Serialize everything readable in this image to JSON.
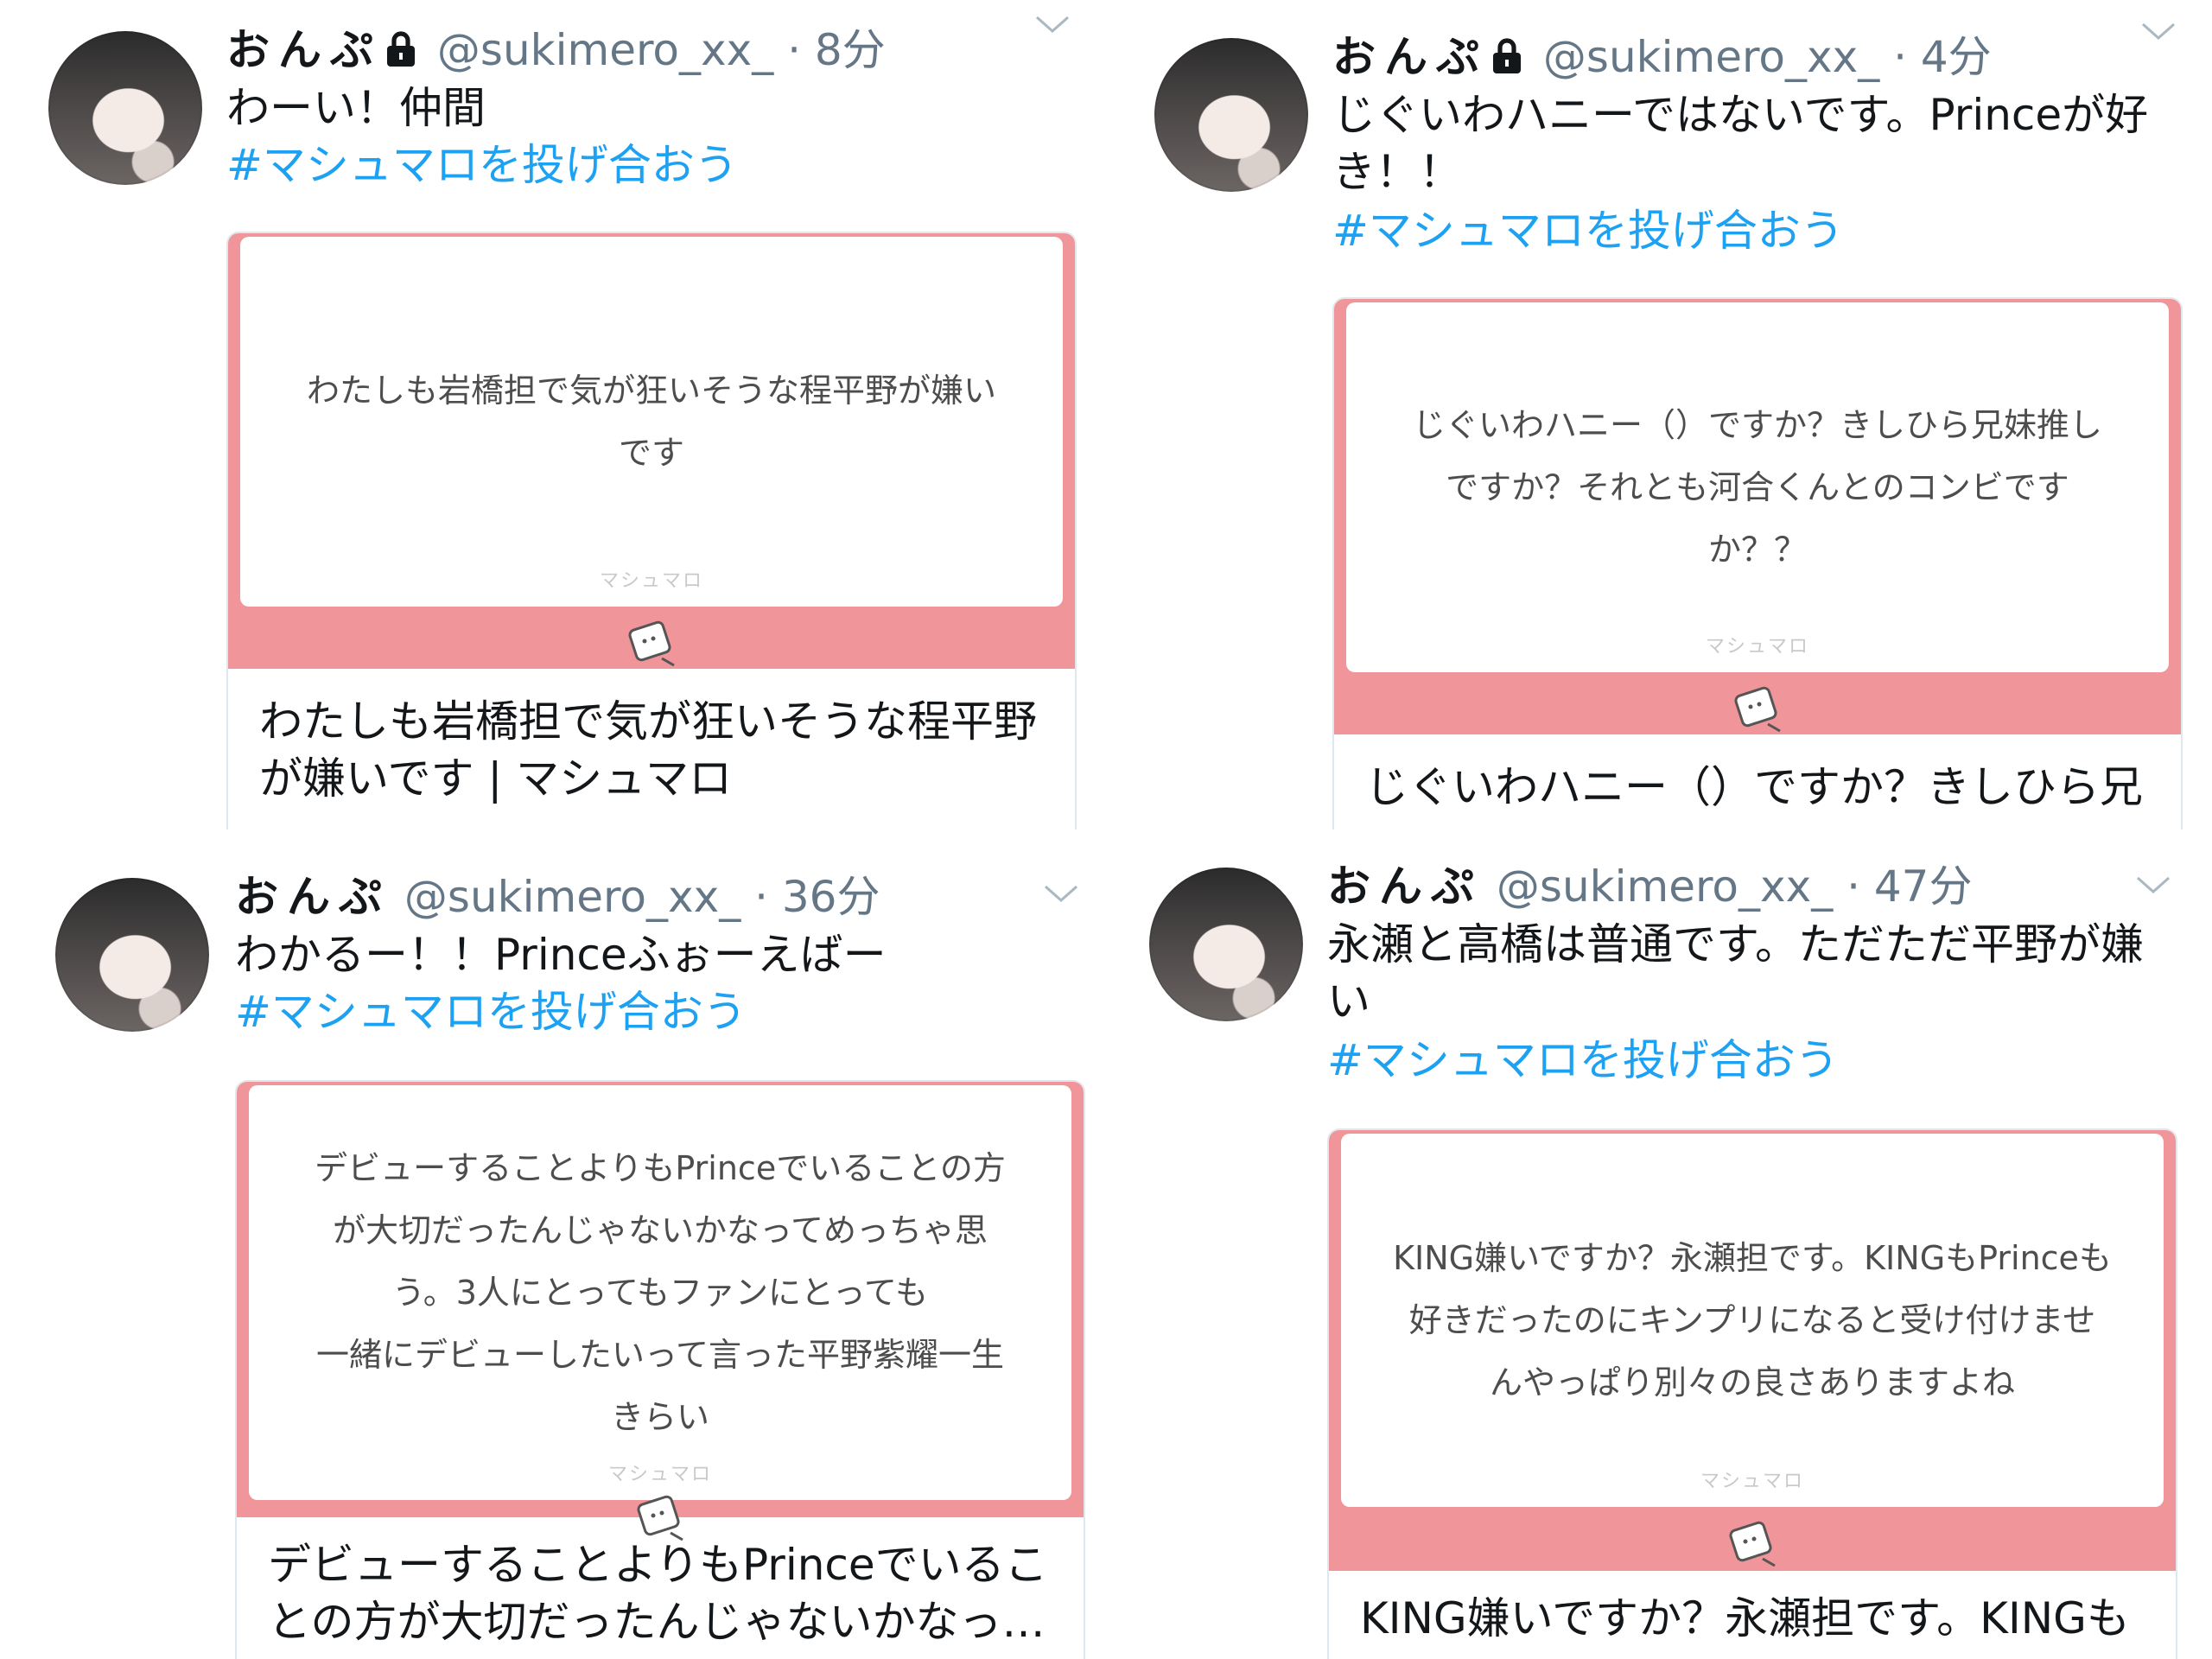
{
  "tweets": [
    {
      "name": "おんぷ",
      "handle": "@sukimero_xx_ · 8分",
      "text": "わーい！仲間",
      "hashtag": "#マシュマロを投げ合おう",
      "question": "わたしも岩橋担で気が狂いそうな程平野が嫌い\nです",
      "brand": "マシュマロ",
      "card_title": "わたしも岩橋担で気が狂いそうな程平野\nが嫌いです | マシュマロ",
      "locked": true
    },
    {
      "name": "おんぷ",
      "handle": "@sukimero_xx_ · 4分",
      "text": "じぐいわハニーではないです。Princeが好\nき！！",
      "hashtag": "#マシュマロを投げ合おう",
      "question": "じぐいわハニー（）ですか？きしひら兄妹推し\nですか？それとも河合くんとのコンビです\nか？？",
      "brand": "マシュマロ",
      "card_title": "じぐいわハニー（）ですか？きしひら兄",
      "locked": true
    },
    {
      "name": "おんぷ",
      "handle": "@sukimero_xx_ · 36分",
      "text": "わかるー！！Princeふぉーえばー",
      "hashtag": "#マシュマロを投げ合おう",
      "question": "デビューすることよりもPrinceでいることの方\nが大切だったんじゃないかなってめっちゃ思\nう。3人にとってもファンにとっても\n一緒にデビューしたいって言った平野紫耀一生\nきらい",
      "brand": "マシュマロ",
      "card_title": "デビューすることよりもPrinceでいるこ\nとの方が大切だったんじゃないかなっ…",
      "locked": false
    },
    {
      "name": "おんぷ",
      "handle": "@sukimero_xx_ · 47分",
      "text": "永瀬と高橋は普通です。ただただ平野が嫌\nい",
      "hashtag": "#マシュマロを投げ合おう",
      "question": "KING嫌いですか？永瀬担です。KINGもPrinceも\n好きだったのにキンプリになると受け付けませ\nんやっぱり別々の良さありますよね",
      "brand": "マシュマロ",
      "card_title": "KING嫌いですか？永瀬担です。KINGも",
      "locked": false
    }
  ],
  "colors": {
    "accent": "#1da1f2",
    "card_pink": "#f0959a",
    "meta": "#657786"
  },
  "icons": {
    "lock": "lock-icon",
    "caret": "chevron-down-icon",
    "mascot": "marshmallow-icon"
  }
}
